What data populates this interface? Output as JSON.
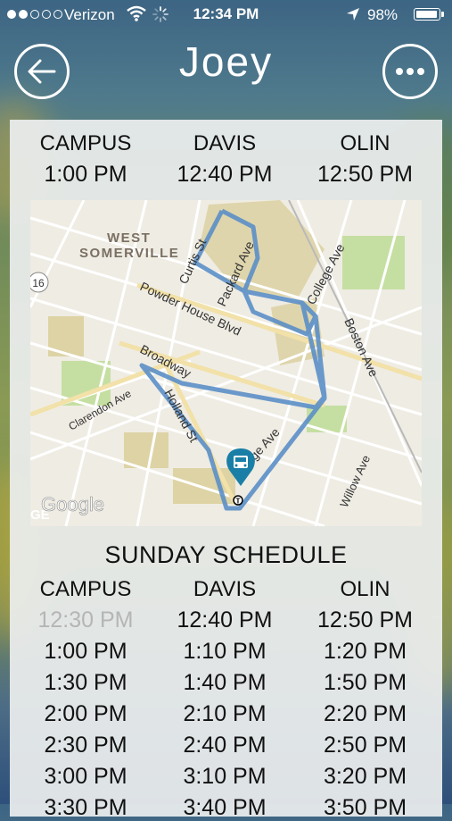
{
  "status_bar": {
    "carrier": "Verizon",
    "time": "12:34 PM",
    "battery": "98%",
    "battery_level": 0.98
  },
  "header": {
    "title": "Joey",
    "back_icon": "back-arrow-icon",
    "more_icon": "more-icon"
  },
  "next_stops": {
    "headers": [
      "CAMPUS",
      "DAVIS",
      "OLIN"
    ],
    "times": [
      "1:00 PM",
      "12:40 PM",
      "12:50 PM"
    ]
  },
  "map": {
    "labels": {
      "neighborhood_line1": "WEST",
      "neighborhood_line2": "SOMERVILLE",
      "curtis": "Curtis St",
      "packard": "Packard Ave",
      "college": "College Ave",
      "boston": "Boston Ave",
      "powder_house": "Powder House Blvd",
      "broadway": "Broadway",
      "clarendon": "Clarendon Ave",
      "holland": "Holland St",
      "college_lower": "ge Ave",
      "willow": "Willow Ave",
      "route": "16",
      "google": "Google",
      "edge_text": "GE"
    },
    "route_color": "#5b8fc7",
    "pin_color": "#1a7fa7"
  },
  "schedule": {
    "title": "SUNDAY SCHEDULE",
    "headers": [
      "CAMPUS",
      "DAVIS",
      "OLIN"
    ],
    "rows": [
      [
        "12:30 PM",
        "12:40 PM",
        "12:50 PM"
      ],
      [
        "1:00 PM",
        "1:10 PM",
        "1:20 PM"
      ],
      [
        "1:30 PM",
        "1:40 PM",
        "1:50 PM"
      ],
      [
        "2:00 PM",
        "2:10 PM",
        "2:20 PM"
      ],
      [
        "2:30 PM",
        "2:40 PM",
        "2:50 PM"
      ],
      [
        "3:00 PM",
        "3:10 PM",
        "3:20 PM"
      ],
      [
        "3:30 PM",
        "3:40 PM",
        "3:50 PM"
      ]
    ]
  }
}
